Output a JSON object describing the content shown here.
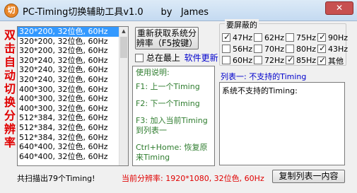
{
  "window": {
    "title": "PC-Timing切换辅助工具v1.0      by   James",
    "icon_letter": "切",
    "close_icon": "✕"
  },
  "vertical_label": "双击自动切换分辨率",
  "resolution_list": {
    "selected_index": 0,
    "items": [
      "320*200, 32位色, 60Hz",
      "320*200, 32位色, 60Hz",
      "320*200, 32位色, 60Hz",
      "320*240, 32位色, 60Hz",
      "320*240, 32位色, 60Hz",
      "320*240, 32位色, 60Hz",
      "400*300, 32位色, 60Hz",
      "400*300, 32位色, 60Hz",
      "400*300, 32位色, 60Hz",
      "512*384, 32位色, 60Hz",
      "512*384, 32位色, 60Hz",
      "512*384, 32位色, 60Hz",
      "640*400, 32位色, 60Hz",
      "640*400, 32位色, 60Hz"
    ]
  },
  "controls": {
    "refresh_button": "重新获取系统分辨率（F5按键）",
    "always_on_top_label": "总在最上",
    "always_on_top_checked": false,
    "update_link": "软件更新"
  },
  "usage": {
    "title": "使用说明:",
    "f1": "F1: 上一个Timing",
    "f2": "F2: 下一个Timing",
    "f3": "F3: 加入当前Timing到列表一",
    "ctrl_home": "Ctrl+Home: 恢复原来Timing"
  },
  "hide_group": {
    "title": "要屏蔽的",
    "options": [
      {
        "label": "47Hz",
        "checked": true
      },
      {
        "label": "62Hz",
        "checked": false
      },
      {
        "label": "75Hz",
        "checked": false
      },
      {
        "label": "90Hz",
        "checked": true
      },
      {
        "label": "56Hz",
        "checked": false
      },
      {
        "label": "70Hz",
        "checked": false
      },
      {
        "label": "80Hz",
        "checked": false
      },
      {
        "label": "43Hz",
        "checked": true
      },
      {
        "label": "60Hz",
        "checked": false
      },
      {
        "label": "72Hz",
        "checked": false
      },
      {
        "label": "85Hz",
        "checked": true
      },
      {
        "label": "其他",
        "checked": true
      }
    ]
  },
  "list1": {
    "title": "列表一: 不支持的Timing",
    "content": "系统不支持的Timing:"
  },
  "status": {
    "count_text": "共扫描出79个Timing!",
    "current_text": "当前分辨率: 1920*1080, 32位色, 60Hz"
  },
  "copy_button": "复制列表一内容",
  "colors": {
    "accent_red": "#e00000",
    "usage_green": "#2f7d2f",
    "link_blue": "#0000cc",
    "selection": "#3399ff"
  }
}
